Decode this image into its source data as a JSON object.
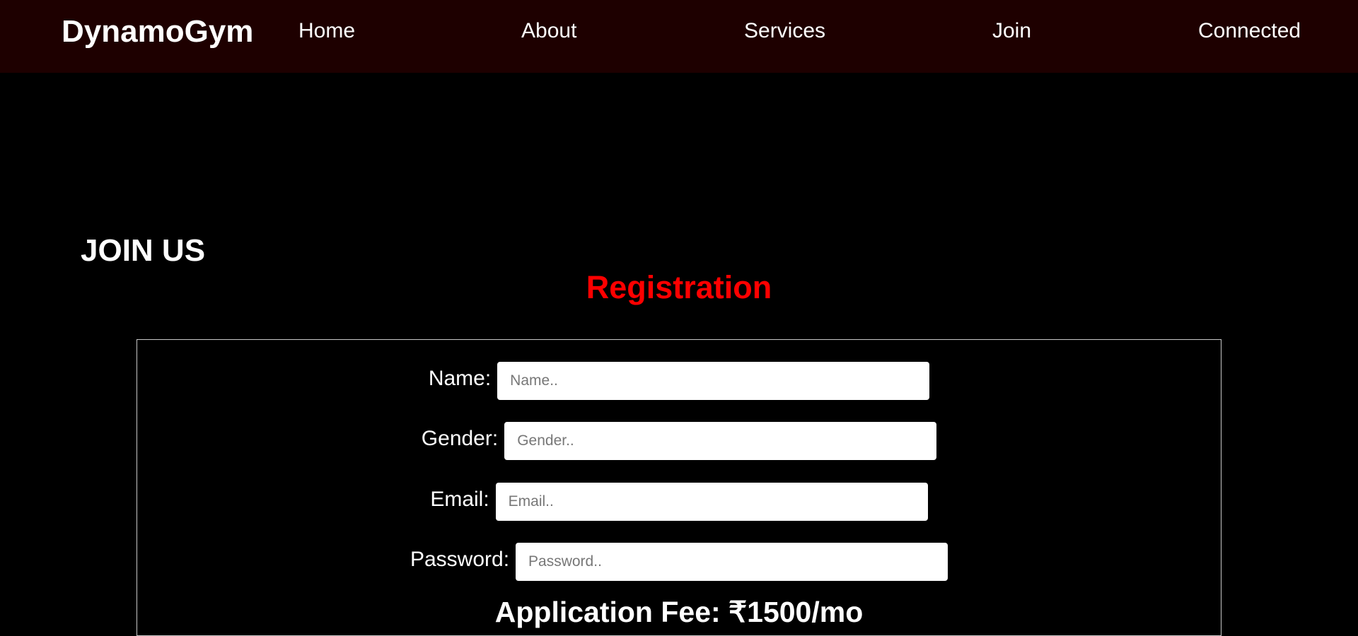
{
  "navbar": {
    "brand": "DynamoGym",
    "links": [
      {
        "label": "Home"
      },
      {
        "label": "About"
      },
      {
        "label": "Services"
      },
      {
        "label": "Join"
      },
      {
        "label": "Connected"
      }
    ]
  },
  "join_section": {
    "title": "JOIN US",
    "form_title": "Registration",
    "fields": [
      {
        "label": "Name:",
        "placeholder": "Name..",
        "value": ""
      },
      {
        "label": "Gender:",
        "placeholder": "Gender..",
        "value": ""
      },
      {
        "label": "Email:",
        "placeholder": "Email..",
        "value": ""
      },
      {
        "label": "Password:",
        "placeholder": "Password..",
        "value": ""
      }
    ],
    "fee_text": "Application Fee: ₹1500/mo"
  },
  "colors": {
    "navbar_bg": "#1e0000",
    "page_bg": "#000000",
    "accent": "#ff0000",
    "text": "#ffffff"
  }
}
